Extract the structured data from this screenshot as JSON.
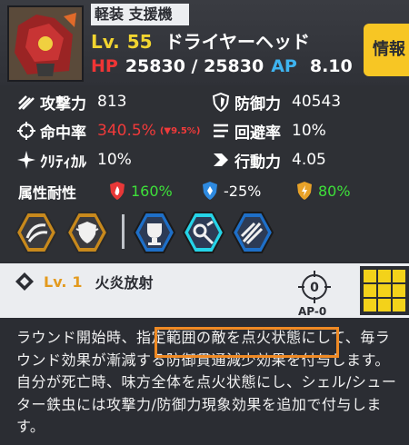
{
  "unit": {
    "class_tag": "軽装 支援機",
    "level_label": "Lv.",
    "level": "55",
    "name": "ドライヤーヘッド",
    "hp_label": "HP",
    "hp": "25830 / 25830",
    "ap_label": "AP",
    "ap": "8.10"
  },
  "info_button": "情報",
  "stats": {
    "attack": {
      "label": "攻撃力",
      "value": "813",
      "icon": "attack-icon"
    },
    "defense": {
      "label": "防御力",
      "value": "40543",
      "icon": "shield-icon"
    },
    "accuracy": {
      "label": "命中率",
      "value": "340.5%",
      "sub": "(▼9.5%)",
      "icon": "crosshair-icon"
    },
    "evasion": {
      "label": "回避率",
      "value": "10%",
      "icon": "evasion-icon"
    },
    "critical": {
      "label": "ｸﾘﾃｨｶﾙ",
      "value": "10%",
      "icon": "critical-icon"
    },
    "mobility": {
      "label": "行動力",
      "value": "4.05",
      "icon": "mobility-icon"
    }
  },
  "resistance": {
    "label": "属性耐性",
    "fire": {
      "value": "160%",
      "color": "#3ee03a",
      "icon": "fire-icon"
    },
    "ice": {
      "value": "-25%",
      "color": "#ffffff",
      "icon": "ice-icon"
    },
    "electric": {
      "value": "80%",
      "color": "#3ee03a",
      "icon": "lightning-icon"
    }
  },
  "skill_icons": [
    "claw-icon",
    "guard-icon",
    "trophy-icon",
    "gear-wrench-icon",
    "missile-icon"
  ],
  "selected_skill": {
    "lv_label": "Lv.",
    "lv": "1",
    "name": "火炎放射",
    "ap_cost": "AP-0",
    "target_count": "0"
  },
  "description": "ラウンド開始時、指定範囲の敵を点火状態にして、毎ラウンド効果が漸減する防御貫通減少効果を付与します。自分が死亡時、味方全体を点火状態にし、シェル/シューター鉄虫には攻撃力/防御力現象効果を追加で付与します。",
  "colors": {
    "accent": "#f2d530",
    "hp": "#f03535",
    "ap": "#3eb4f0",
    "highlight": "#f08a24"
  }
}
